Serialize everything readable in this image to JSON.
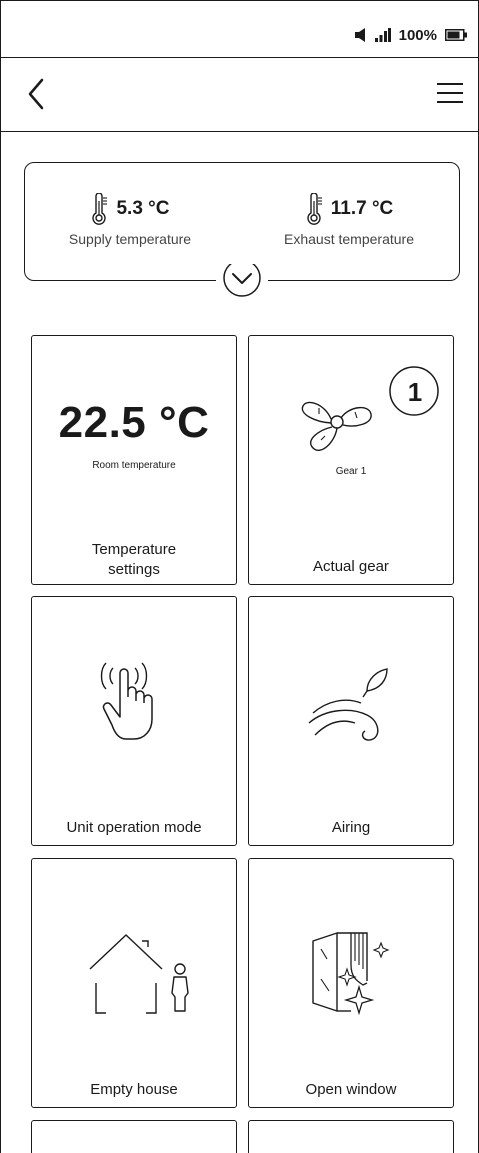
{
  "status_bar": {
    "battery_text": "100%",
    "icons": [
      "volume-icon",
      "signal-icon",
      "battery-icon"
    ]
  },
  "nav": {
    "back_icon": "chevron-left-icon",
    "menu_icon": "hamburger-menu-icon"
  },
  "summary": {
    "supply": {
      "value": "5.3 °C",
      "label": "Supply temperature",
      "icon": "thermometer-icon"
    },
    "exhaust": {
      "value": "11.7 °C",
      "label": "Exhaust temperature",
      "icon": "thermometer-icon"
    },
    "expand_icon": "chevron-down-icon"
  },
  "tiles": {
    "temperature": {
      "value": "22.5 °C",
      "sublabel": "Room temperature",
      "label": "Temperature settings"
    },
    "gear": {
      "number": "1",
      "sublabel": "Gear 1",
      "label": "Actual gear",
      "icon": "fan-icon"
    },
    "operation_mode": {
      "label": "Unit operation mode",
      "icon": "touch-hand-icon"
    },
    "airing": {
      "label": "Airing",
      "icon": "wind-leaf-icon"
    },
    "empty_house": {
      "label": "Empty house",
      "icon": "house-person-icon"
    },
    "open_window": {
      "label": "Open window",
      "icon": "open-window-icon"
    }
  }
}
